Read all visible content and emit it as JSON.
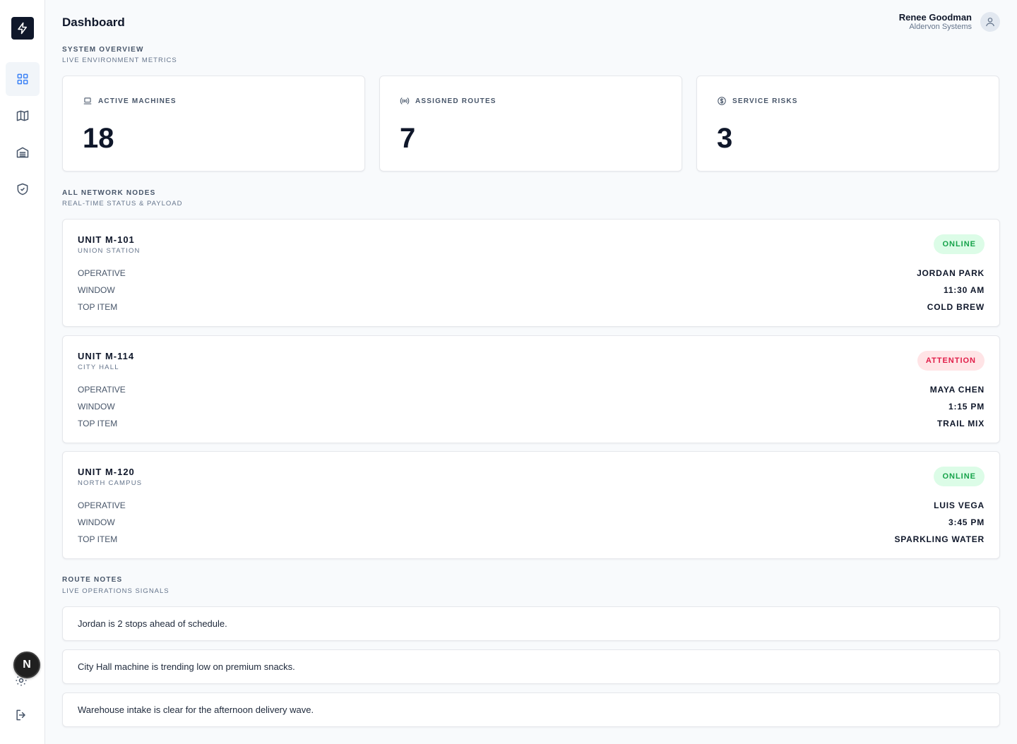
{
  "header": {
    "title": "Dashboard",
    "user_name": "Renee Goodman",
    "user_org": "Aldervon Systems"
  },
  "sidebar": {
    "items": [
      {
        "icon": "grid-icon",
        "active": true
      },
      {
        "icon": "map-icon",
        "active": false
      },
      {
        "icon": "warehouse-icon",
        "active": false
      },
      {
        "icon": "shield-icon",
        "active": false
      }
    ],
    "avatar_letter": "N"
  },
  "overview": {
    "title": "SYSTEM OVERVIEW",
    "subtitle": "LIVE ENVIRONMENT METRICS",
    "stats": [
      {
        "label": "ACTIVE MACHINES",
        "value": "18",
        "icon": "laptop-icon"
      },
      {
        "label": "ASSIGNED ROUTES",
        "value": "7",
        "icon": "broadcast-icon"
      },
      {
        "label": "SERVICE RISKS",
        "value": "3",
        "icon": "dollar-circle-icon"
      }
    ]
  },
  "nodes": {
    "title": "ALL NETWORK NODES",
    "subtitle": "REAL-TIME STATUS & PAYLOAD",
    "row_labels": {
      "operative": "OPERATIVE",
      "window": "WINDOW",
      "top_item": "TOP ITEM"
    },
    "items": [
      {
        "name": "UNIT M-101",
        "location": "UNION STATION",
        "status": "ONLINE",
        "operative": "JORDAN PARK",
        "window": "11:30 AM",
        "top_item": "COLD BREW"
      },
      {
        "name": "UNIT M-114",
        "location": "CITY HALL",
        "status": "ATTENTION",
        "operative": "MAYA CHEN",
        "window": "1:15 PM",
        "top_item": "TRAIL MIX"
      },
      {
        "name": "UNIT M-120",
        "location": "NORTH CAMPUS",
        "status": "ONLINE",
        "operative": "LUIS VEGA",
        "window": "3:45 PM",
        "top_item": "SPARKLING WATER"
      }
    ]
  },
  "notes": {
    "title": "ROUTE NOTES",
    "subtitle": "LIVE OPERATIONS SIGNALS",
    "items": [
      "Jordan is 2 stops ahead of schedule.",
      "City Hall machine is trending low on premium snacks.",
      "Warehouse intake is clear for the afternoon delivery wave."
    ]
  },
  "colors": {
    "accent": "#3b82f6",
    "online": "#16a34a",
    "attention": "#e11d48",
    "dark": "#0f172a"
  }
}
